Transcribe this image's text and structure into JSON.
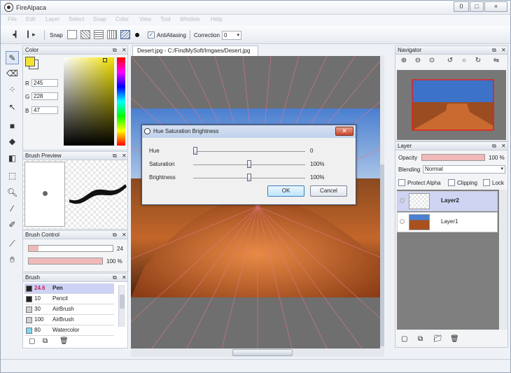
{
  "app": {
    "title": "FireAlpaca"
  },
  "window_buttons": [
    "0",
    "□",
    "×"
  ],
  "menu": [
    "File",
    "Edit",
    "Layer",
    "Select",
    "Snap",
    "Color",
    "View",
    "Tool",
    "Window",
    "Help"
  ],
  "toolbar": {
    "snap_label": "Snap",
    "antialiasing_label": "AntiAliasing",
    "antialiasing_checked": true,
    "correction_label": "Correction",
    "correction_value": "0"
  },
  "document_tab": "Desert.jpg - C:/FindMySoft/Imgaes/Desert.jpg",
  "color_panel": {
    "title": "Color",
    "r_label": "R",
    "r_value": "245",
    "g_label": "G",
    "g_value": "228",
    "b_label": "B",
    "b_value": "47",
    "primary_color": "#f5e42f",
    "secondary_color": "#ffffff"
  },
  "brush_preview": {
    "title": "Brush Preview"
  },
  "brush_control": {
    "title": "Brush Control",
    "size_value": "24",
    "opacity_value": "100 %",
    "size_level": 0.12,
    "opacity_level": 1.0
  },
  "brush_panel": {
    "title": "Brush",
    "items": [
      {
        "size": "24.6",
        "name": "Pen",
        "color": "#222222"
      },
      {
        "size": "10",
        "name": "Pencil",
        "color": "#222222"
      },
      {
        "size": "30",
        "name": "AirBrush",
        "color": "#cfcfcf"
      },
      {
        "size": "100",
        "name": "AirBrush",
        "color": "#cfcfcf"
      },
      {
        "size": "80",
        "name": "Watercolor",
        "color": "#7fd6f0"
      }
    ]
  },
  "dialog": {
    "title": "Hue Saturation Brightness",
    "hue_label": "Hue",
    "hue_value": "0",
    "hue_level": 0.0,
    "saturation_label": "Saturation",
    "saturation_value": "100%",
    "saturation_level": 0.5,
    "brightness_label": "Brightness",
    "brightness_value": "100%",
    "brightness_level": 0.5,
    "ok_label": "OK",
    "cancel_label": "Cancel"
  },
  "navigator": {
    "title": "Navigator"
  },
  "layer_panel": {
    "title": "Layer",
    "opacity_label": "Opacity",
    "opacity_value": "100 %",
    "blending_label": "Blending",
    "blending_value": "Normal",
    "protect_alpha_label": "Protect Alpha",
    "clipping_label": "Clipping",
    "lock_label": "Lock",
    "layers": [
      {
        "name": "Layer2",
        "selected": true
      },
      {
        "name": "Layer1",
        "selected": false
      }
    ]
  }
}
